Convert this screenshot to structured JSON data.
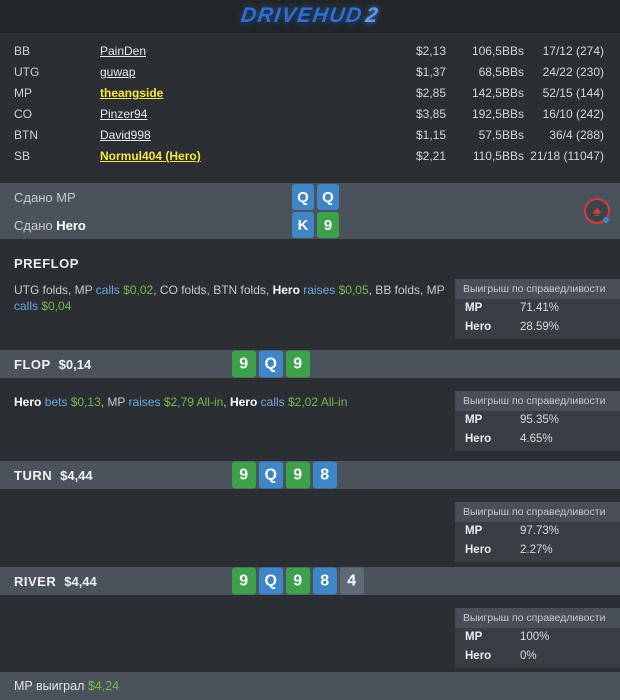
{
  "header": {
    "logo_text": "DRIVEHUD",
    "logo_suffix": "2"
  },
  "palette": {
    "accent_yellow": "#f7e843",
    "amount_green": "#76b84e",
    "verb_blue": "#6fa8dc",
    "logo_blue": "#2f6fce",
    "bar_bg": "#4a525c",
    "card_blue": "#3e86c6",
    "card_green": "#3da04a",
    "card_gray": "#5d6b77"
  },
  "players": {
    "rows": [
      {
        "position": "BB",
        "name": "PainDen",
        "stack": "$2,13",
        "bbs": "106,5BBs",
        "stats": "17/12 (274)"
      },
      {
        "position": "UTG",
        "name": "guwap",
        "stack": "$1,37",
        "bbs": "68,5BBs",
        "stats": "24/22 (230)"
      },
      {
        "position": "MP",
        "name": "theangside",
        "stack": "$2,85",
        "bbs": "142,5BBs",
        "stats": "52/15 (144)"
      },
      {
        "position": "CO",
        "name": "Pinzer94",
        "stack": "$3,85",
        "bbs": "192,5BBs",
        "stats": "16/10 (242)"
      },
      {
        "position": "BTN",
        "name": "David998",
        "stack": "$1,15",
        "bbs": "57,5BBs",
        "stats": "36/4 (288)"
      },
      {
        "position": "SB",
        "name": "Normul404 (Hero)",
        "stack": "$2,21",
        "bbs": "110,5BBs",
        "stats": "21/18 (11047)"
      }
    ]
  },
  "dealt": {
    "rows": [
      {
        "tokens": [
          {
            "t": "Сдано MP",
            "k": "plain"
          }
        ],
        "cards": [
          {
            "rank": "Q",
            "color": "blue"
          },
          {
            "rank": "Q",
            "color": "blue"
          }
        ]
      },
      {
        "tokens": [
          {
            "t": "Сдано ",
            "k": "plain"
          },
          {
            "t": "Hero",
            "k": "hero"
          }
        ],
        "cards": [
          {
            "rank": "K",
            "color": "blue"
          },
          {
            "rank": "9",
            "color": "green"
          }
        ]
      }
    ]
  },
  "streets": {
    "preflop": {
      "label": "PREFLOP",
      "tokens": [
        {
          "t": "UTG folds, MP ",
          "k": "plain"
        },
        {
          "t": "calls",
          "k": "verb"
        },
        {
          "t": " ",
          "k": "plain"
        },
        {
          "t": "$0,02",
          "k": "amt"
        },
        {
          "t": ", CO folds, BTN folds, ",
          "k": "plain"
        },
        {
          "t": "Hero",
          "k": "hero"
        },
        {
          "t": " ",
          "k": "plain"
        },
        {
          "t": "raises",
          "k": "verb"
        },
        {
          "t": " ",
          "k": "plain"
        },
        {
          "t": "$0,05",
          "k": "amt"
        },
        {
          "t": ", BB folds, MP ",
          "k": "plain"
        },
        {
          "t": "calls",
          "k": "verb"
        },
        {
          "t": " ",
          "k": "plain"
        },
        {
          "t": "$0,04",
          "k": "amt"
        }
      ],
      "equity": {
        "title": "Выигрыш по справедливости",
        "rows": [
          {
            "name": "MP",
            "value": "71.41%"
          },
          {
            "name": "Hero",
            "value": "28.59%"
          }
        ]
      }
    },
    "flop": {
      "label": "FLOP",
      "pot": "$0,14",
      "cards": [
        {
          "rank": "9",
          "color": "green"
        },
        {
          "rank": "Q",
          "color": "blue"
        },
        {
          "rank": "9",
          "color": "green"
        }
      ],
      "tokens": [
        {
          "t": "Hero",
          "k": "hero"
        },
        {
          "t": " ",
          "k": "plain"
        },
        {
          "t": "bets",
          "k": "verb"
        },
        {
          "t": " ",
          "k": "plain"
        },
        {
          "t": "$0,13",
          "k": "amt"
        },
        {
          "t": ", MP ",
          "k": "plain"
        },
        {
          "t": "raises",
          "k": "verb"
        },
        {
          "t": " ",
          "k": "plain"
        },
        {
          "t": "$2,79 All-in",
          "k": "amt"
        },
        {
          "t": ", ",
          "k": "plain"
        },
        {
          "t": "Hero",
          "k": "hero"
        },
        {
          "t": " ",
          "k": "plain"
        },
        {
          "t": "calls",
          "k": "verb"
        },
        {
          "t": " ",
          "k": "plain"
        },
        {
          "t": "$2,02 All-in",
          "k": "amt"
        }
      ],
      "equity": {
        "title": "Выигрыш по справедливости",
        "rows": [
          {
            "name": "MP",
            "value": "95.35%"
          },
          {
            "name": "Hero",
            "value": "4.65%"
          }
        ]
      }
    },
    "turn": {
      "label": "TURN",
      "pot": "$4,44",
      "cards": [
        {
          "rank": "9",
          "color": "green"
        },
        {
          "rank": "Q",
          "color": "blue"
        },
        {
          "rank": "9",
          "color": "green"
        },
        {
          "rank": "8",
          "color": "blue"
        }
      ],
      "equity": {
        "title": "Выигрыш по справедливости",
        "rows": [
          {
            "name": "MP",
            "value": "97.73%"
          },
          {
            "name": "Hero",
            "value": "2.27%"
          }
        ]
      }
    },
    "river": {
      "label": "RIVER",
      "pot": "$4,44",
      "cards": [
        {
          "rank": "9",
          "color": "green"
        },
        {
          "rank": "Q",
          "color": "blue"
        },
        {
          "rank": "9",
          "color": "green"
        },
        {
          "rank": "8",
          "color": "blue"
        },
        {
          "rank": "4",
          "color": "gray"
        }
      ],
      "equity": {
        "title": "Выигрыш по справедливости",
        "rows": [
          {
            "name": "MP",
            "value": "100%"
          },
          {
            "name": "Hero",
            "value": "0%"
          }
        ]
      }
    }
  },
  "footer": {
    "tokens": [
      {
        "t": "MP выиграл ",
        "k": "plain"
      },
      {
        "t": "$4,24",
        "k": "amt"
      }
    ]
  }
}
